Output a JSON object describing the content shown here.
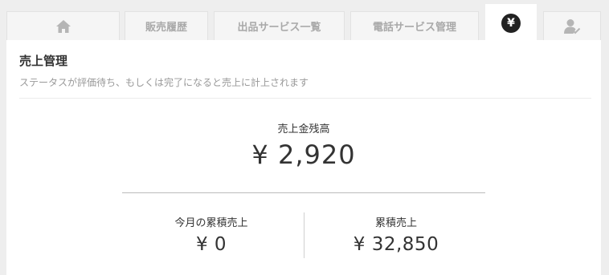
{
  "tabs": [
    {
      "id": "home",
      "icon": "home-icon"
    },
    {
      "id": "sales-history",
      "label": "販売履歴"
    },
    {
      "id": "services",
      "label": "出品サービス一覧"
    },
    {
      "id": "phone",
      "label": "電話サービス管理"
    },
    {
      "id": "sales",
      "icon": "yen-icon",
      "glyph": "¥",
      "active": true
    },
    {
      "id": "profile",
      "icon": "user-check-icon"
    }
  ],
  "page": {
    "title": "売上管理",
    "subtitle": "ステータスが評価待ち、もしくは完了になると売上に計上されます"
  },
  "balance": {
    "label": "売上金残高",
    "value": "¥ 2,920"
  },
  "monthly": {
    "label": "今月の累積売上",
    "value": "¥ 0"
  },
  "cumulative": {
    "label": "累積売上",
    "value": "¥ 32,850"
  },
  "colors": {
    "background": "#eeeeee",
    "panel": "#ffffff",
    "tab_text": "#a9a9a9",
    "active_icon": "#222222"
  }
}
